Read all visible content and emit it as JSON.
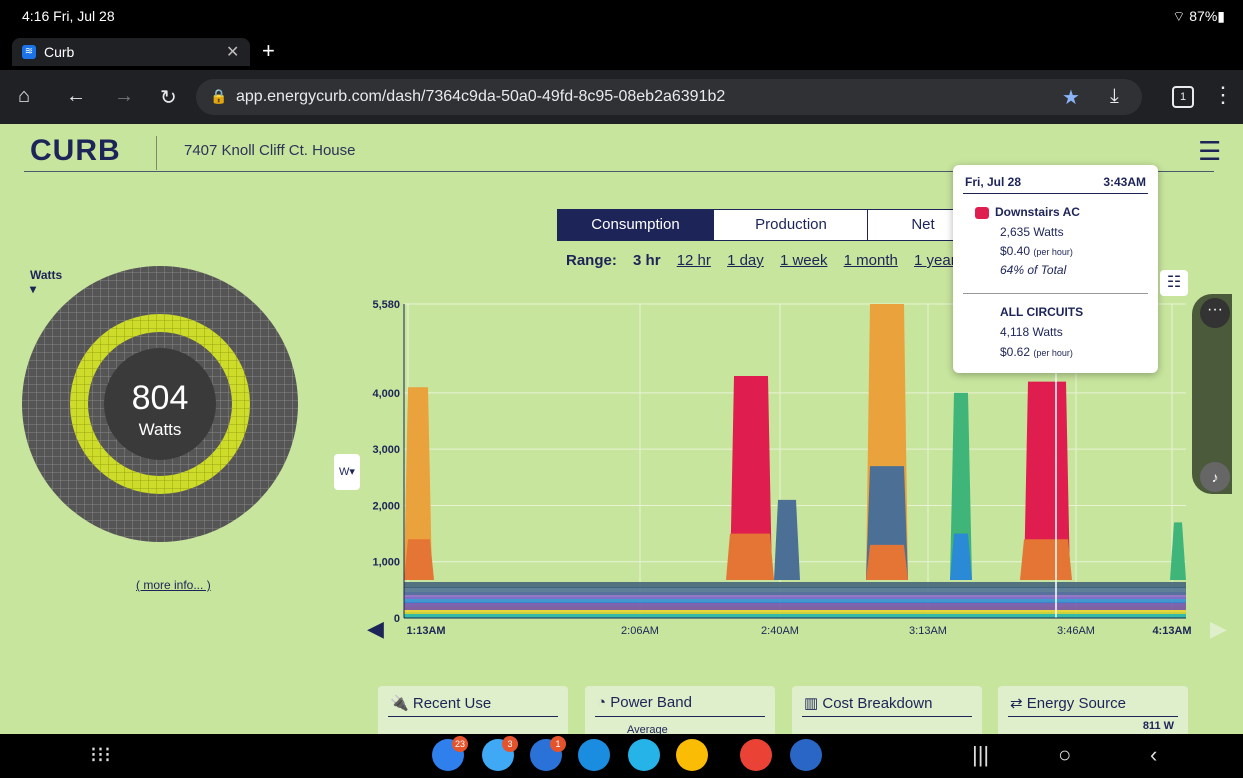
{
  "statusbar": {
    "time": "4:16  Fri, Jul 28",
    "battery": "87%"
  },
  "browser": {
    "tab_title": "Curb",
    "url": "app.energycurb.com/dash/7364c9da-50a0-49fd-8c95-08eb2a6391b2",
    "tab_count": "1"
  },
  "header": {
    "logo": "CURB",
    "house": "7407 Knoll Cliff Ct. House"
  },
  "view_tabs": [
    "Consumption",
    "Production",
    "Net"
  ],
  "range": {
    "label": "Range:",
    "options": [
      "3 hr",
      "12 hr",
      "1 day",
      "1 week",
      "1 month",
      "1 year"
    ]
  },
  "donut": {
    "unit_label": "Watts",
    "value": "804",
    "unit": "Watts",
    "more_info": "( more info... )"
  },
  "unit_button": "W",
  "tooltip": {
    "date": "Fri, Jul 28",
    "time": "3:43AM",
    "circuit": "Downstairs AC",
    "watts": "2,635 Watts",
    "cost": "$0.40",
    "per": "(per hour)",
    "pct": "64% of Total",
    "all_label": "ALL CIRCUITS",
    "all_watts": "4,118 Watts",
    "all_cost": "$0.62",
    "all_per": "(per hour)"
  },
  "chart_data": {
    "type": "area",
    "x_ticks": [
      "1:13AM",
      "2:06AM",
      "2:40AM",
      "3:13AM",
      "3:46AM",
      "4:13AM"
    ],
    "y_ticks": [
      "0",
      "1,000",
      "2,000",
      "3,000",
      "4,000",
      "5,580"
    ],
    "ylim": [
      0,
      5580
    ],
    "series": [
      {
        "name": "Downstairs AC",
        "color": "#e01d4f"
      }
    ]
  },
  "cards": [
    {
      "title": "Recent Use",
      "icon": "plug"
    },
    {
      "title": "Power Band",
      "icon": "gauge",
      "sub": "Average"
    },
    {
      "title": "Cost Breakdown",
      "icon": "bar-chart"
    },
    {
      "title": "Energy Source",
      "icon": "arrows",
      "value": "811 W"
    }
  ],
  "dock_badges": [
    "23",
    "3",
    "1"
  ]
}
